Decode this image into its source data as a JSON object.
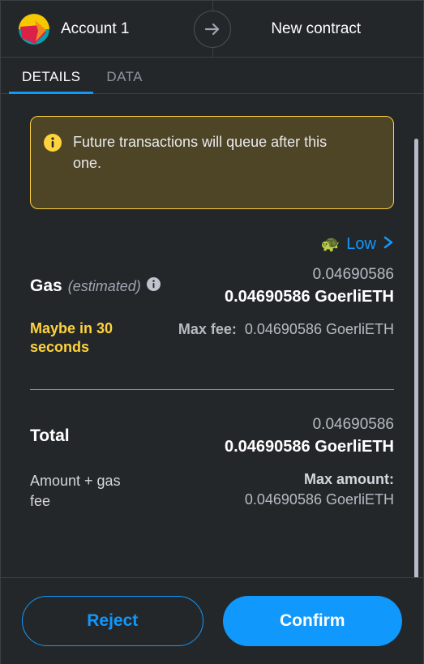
{
  "header": {
    "account_name": "Account 1",
    "recipient_name": "New contract",
    "avatar_icon": "jazzicon-avatar",
    "arrow_icon": "arrow-right-icon"
  },
  "tabs": [
    {
      "label": "DETAILS",
      "active": true
    },
    {
      "label": "DATA",
      "active": false
    }
  ],
  "banner": {
    "icon": "info-circle-icon",
    "message": "Future transactions will queue after this one.",
    "border_color": "#ffd33d",
    "background_color": "#4e4426"
  },
  "gas_selector": {
    "emoji": "🐢",
    "level": "Low",
    "chevron_icon": "chevron-right-icon",
    "accent_color": "#1098fc"
  },
  "gas": {
    "label": "Gas",
    "estimated_label": "(estimated)",
    "info_icon": "info-circle-icon",
    "secondary_value": "0.04690586",
    "primary_value": "0.04690586 GoerliETH"
  },
  "speed": {
    "text": "Maybe in 30 seconds",
    "color": "#ffd33d",
    "max_fee_label": "Max fee:",
    "max_fee_value": "0.04690586 GoerliETH"
  },
  "total": {
    "label": "Total",
    "secondary_value": "0.04690586",
    "primary_value": "0.04690586 GoerliETH",
    "description": "Amount + gas fee",
    "max_amount_label": "Max amount:",
    "max_amount_value": "0.04690586 GoerliETH"
  },
  "footer": {
    "reject_label": "Reject",
    "confirm_label": "Confirm",
    "confirm_color": "#1098fc"
  }
}
